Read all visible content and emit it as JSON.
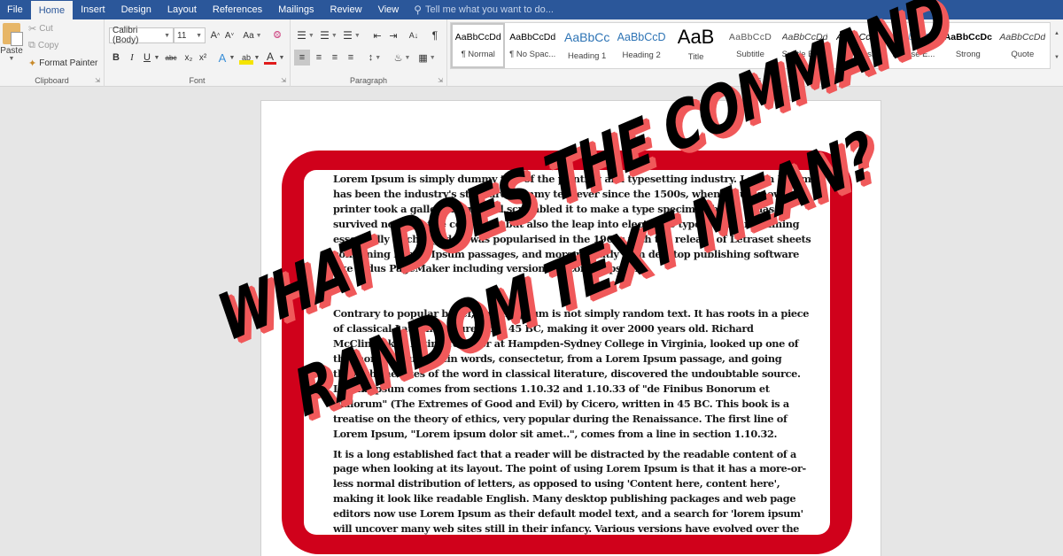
{
  "ribbon_tabs": [
    {
      "label": "File"
    },
    {
      "label": "Home"
    },
    {
      "label": "Insert"
    },
    {
      "label": "Design"
    },
    {
      "label": "Layout"
    },
    {
      "label": "References"
    },
    {
      "label": "Mailings"
    },
    {
      "label": "Review"
    },
    {
      "label": "View"
    }
  ],
  "active_tab": "Home",
  "tell_me": {
    "placeholder": "Tell me what you want to do...",
    "icon": "lightbulb-icon"
  },
  "clipboard": {
    "group_label": "Clipboard",
    "paste_label": "Paste",
    "cut_label": "Cut",
    "copy_label": "Copy",
    "format_painter_label": "Format Painter"
  },
  "font": {
    "group_label": "Font",
    "font_name": "Calibri (Body)",
    "font_size": "11",
    "grow_label": "A",
    "shrink_label": "A",
    "change_case_label": "Aa",
    "bold": "B",
    "italic": "I",
    "underline": "U",
    "strike": "abc",
    "subscript": "x₂",
    "superscript": "x²",
    "font_color_label": "A",
    "highlight_label": "ab"
  },
  "paragraph": {
    "group_label": "Paragraph",
    "pilcrow": "¶",
    "sort": "A↓"
  },
  "styles": {
    "group_label": "Styles",
    "items": [
      {
        "sample": "AaBbCcDd",
        "name": "¶ Normal",
        "selected": true
      },
      {
        "sample": "AaBbCcDd",
        "name": "¶ No Spac..."
      },
      {
        "sample": "AaBbCc",
        "name": "Heading 1"
      },
      {
        "sample": "AaBbCcD",
        "name": "Heading 2"
      },
      {
        "sample": "AaB",
        "name": "Title"
      },
      {
        "sample": "AaBbCcD",
        "name": "Subtitle"
      },
      {
        "sample": "AaBbCcDd",
        "name": "Subtle Em..."
      },
      {
        "sample": "AaBbCcDd",
        "name": "Emphasis"
      },
      {
        "sample": "AaBbCcDd",
        "name": "Intense E..."
      },
      {
        "sample": "AaBbCcDc",
        "name": "Strong"
      },
      {
        "sample": "AaBbCcDd",
        "name": "Quote"
      }
    ]
  },
  "document": {
    "paragraphs": [
      "Lorem Ipsum is simply dummy text of the printing and typesetting industry. Lorem Ipsum has been the industry's standard dummy text ever since the 1500s, when an unknown printer took a galley of type and scrambled it to make a type specimen book. It has survived not only five centuries, but also the leap into electronic typesetting, remaining essentially unchanged. It was popularised in the 1960s with the release of Letraset sheets containing Lorem Ipsum passages, and more recently with desktop publishing software like Aldus PageMaker including versions of Lorem Ipsum.",
      "Contrary to popular belief, Lorem Ipsum is not simply random text. It has roots in a piece of classical Latin literature from 45 BC, making it over 2000 years old. Richard McClintock, a Latin professor at Hampden-Sydney College in Virginia, looked up one of the more obscure Latin words, consectetur, from a Lorem Ipsum passage, and going through the cites of the word in classical literature, discovered the undoubtable source. Lorem Ipsum comes from sections 1.10.32 and 1.10.33 of \"de Finibus Bonorum et Malorum\" (The Extremes of Good and Evil) by Cicero, written in 45 BC. This book is a treatise on the theory of ethics, very popular during the Renaissance. The first line of Lorem Ipsum, \"Lorem ipsum dolor sit amet..\", comes from a line in section 1.10.32.",
      "It is a long established fact that a reader will be distracted by the readable content of a page when looking at its layout. The point of using Lorem Ipsum is that it has a more-or-less normal distribution of letters, as opposed to using 'Content here, content here', making it look like readable English. Many desktop publishing packages and web page editors now use Lorem Ipsum as their default model text, and a search for 'lorem ipsum' will uncover many web sites still in their infancy. Various versions have evolved over the"
    ]
  },
  "headline": {
    "line1": "WHAT DOES THE COMMAND",
    "line2": "RANDOM TEXT MEAN?"
  },
  "colors": {
    "tabbar": "#2b579a",
    "frame_red": "#d0011b",
    "headline_shadow": "#f0595a"
  }
}
